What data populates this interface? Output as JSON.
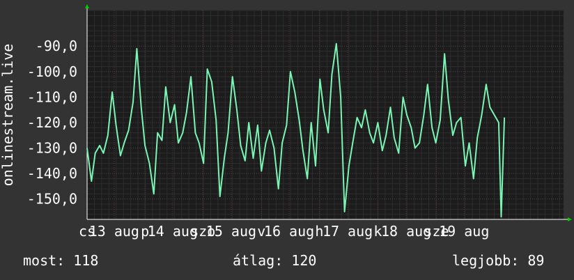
{
  "chart_data": {
    "type": "line",
    "ylabel": "onlinestream.live",
    "ylim": [
      -158,
      -76
    ],
    "yticks": [
      -150,
      -140,
      -130,
      -120,
      -110,
      -100,
      -90
    ],
    "ytick_labels": [
      "-150,0",
      "-140,0",
      "-130,0",
      "-120,0",
      "-110,0",
      "-100,0",
      "-90,0"
    ],
    "xlim": [
      0,
      7.57
    ],
    "xticks": [
      {
        "pos": 0.0,
        "label": "cs"
      },
      {
        "pos": 0.43,
        "label": "13 aug"
      },
      {
        "pos": 0.92,
        "label": "p"
      },
      {
        "pos": 1.36,
        "label": "14 aug"
      },
      {
        "pos": 1.84,
        "label": "szo"
      },
      {
        "pos": 2.29,
        "label": "15 aug"
      },
      {
        "pos": 2.77,
        "label": "v"
      },
      {
        "pos": 3.21,
        "label": "16 aug"
      },
      {
        "pos": 3.69,
        "label": "h"
      },
      {
        "pos": 4.14,
        "label": "17 aug"
      },
      {
        "pos": 4.62,
        "label": "k"
      },
      {
        "pos": 5.07,
        "label": "18 aug"
      },
      {
        "pos": 5.55,
        "label": "sze"
      },
      {
        "pos": 5.99,
        "label": "19 aug"
      }
    ],
    "grid": true,
    "colors": {
      "background": "#333333",
      "plot": "#1c1c1c",
      "line": "#7af5b3",
      "grid_major": "#4a4a4a",
      "grid_minor": "#2d2d2d",
      "arrow": "#00cc00"
    },
    "series": [
      {
        "color": "#7af5b3",
        "x": [
          0.0,
          0.07,
          0.13,
          0.2,
          0.26,
          0.33,
          0.4,
          0.46,
          0.53,
          0.59,
          0.66,
          0.73,
          0.79,
          0.86,
          0.92,
          0.99,
          1.06,
          1.12,
          1.19,
          1.25,
          1.32,
          1.39,
          1.45,
          1.52,
          1.58,
          1.65,
          1.72,
          1.78,
          1.85,
          1.91,
          1.98,
          2.05,
          2.11,
          2.18,
          2.24,
          2.31,
          2.38,
          2.44,
          2.51,
          2.57,
          2.64,
          2.71,
          2.77,
          2.84,
          2.9,
          2.97,
          3.04,
          3.1,
          3.17,
          3.23,
          3.3,
          3.37,
          3.43,
          3.5,
          3.56,
          3.63,
          3.7,
          3.76,
          3.83,
          3.89,
          3.96,
          4.03,
          4.09,
          4.16,
          4.22,
          4.29,
          4.36,
          4.42,
          4.49,
          4.55,
          4.62,
          4.69,
          4.75,
          4.82,
          4.88,
          4.95,
          5.02,
          5.08,
          5.15,
          5.21,
          5.28,
          5.35,
          5.41,
          5.48,
          5.54,
          5.61,
          5.68,
          5.74,
          5.81,
          5.87,
          5.94,
          6.01,
          6.07,
          6.14,
          6.2,
          6.27,
          6.34,
          6.4,
          6.47,
          6.54,
          6.58,
          6.63
        ],
        "y": [
          -130,
          -143,
          -132,
          -129,
          -132,
          -125,
          -108,
          -121,
          -133,
          -128,
          -123,
          -112,
          -91,
          -114,
          -129,
          -136,
          -148,
          -124,
          -127,
          -106,
          -120,
          -113,
          -128,
          -124,
          -116,
          -102,
          -124,
          -128,
          -136,
          -99,
          -104,
          -119,
          -149,
          -134,
          -124,
          -102,
          -115,
          -129,
          -135,
          -120,
          -134,
          -121,
          -139,
          -128,
          -123,
          -130,
          -146,
          -128,
          -121,
          -100,
          -108,
          -119,
          -131,
          -142,
          -120,
          -137,
          -103,
          -115,
          -124,
          -101,
          -89,
          -110,
          -155,
          -137,
          -128,
          -118,
          -122,
          -115,
          -124,
          -128,
          -120,
          -131,
          -125,
          -114,
          -126,
          -132,
          -110,
          -117,
          -122,
          -130,
          -128,
          -117,
          -105,
          -122,
          -128,
          -119,
          -93,
          -111,
          -125,
          -120,
          -118,
          -137,
          -128,
          -142,
          -126,
          -117,
          -105,
          -114,
          -117,
          -120,
          -157,
          -118
        ]
      }
    ]
  },
  "footer": {
    "current": "most: 118",
    "average": "átlag: 120",
    "max": "legjobb: 89"
  }
}
